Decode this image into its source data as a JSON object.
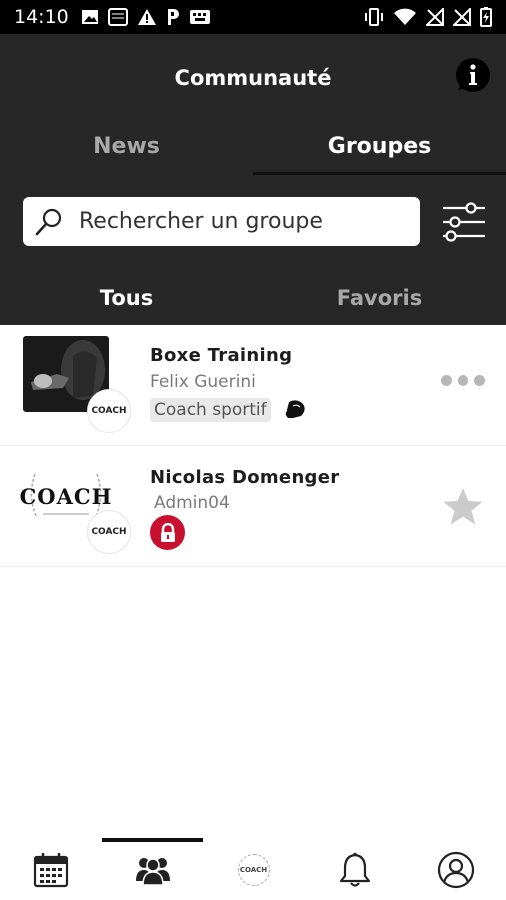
{
  "status_bar": {
    "time": "14:10",
    "left_icons": [
      "image-icon",
      "notes-icon",
      "warning-icon",
      "parking-icon",
      "keyboard-icon"
    ],
    "right_icons": [
      "vibrate-icon",
      "wifi-icon",
      "no-signal-icon",
      "no-signal-icon",
      "battery-charging-icon"
    ]
  },
  "header": {
    "title": "Communauté",
    "info_icon": "info-icon"
  },
  "tabs": {
    "news": "News",
    "groups": "Groupes",
    "active": "groups"
  },
  "search": {
    "placeholder": "Rechercher un groupe",
    "value": ""
  },
  "filter_icon": "sliders-icon",
  "subtabs": {
    "all": "Tous",
    "favorites": "Favoris",
    "active": "all"
  },
  "groups": [
    {
      "name": "Boxe Training",
      "owner": "Felix Guerini",
      "tag": "Coach sportif",
      "tag_icon": "boxing-glove-icon",
      "badge_text": "COACH",
      "action_icon": "more-icon"
    },
    {
      "name": "Nicolas Domenger",
      "owner": "Admin04",
      "logo_text": "COACH",
      "badge_text": "COACH",
      "private_icon": "lock-icon",
      "action_icon": "star-icon"
    }
  ],
  "bottom_nav": {
    "items": [
      {
        "icon": "calendar-icon"
      },
      {
        "icon": "community-icon"
      },
      {
        "icon": "coach-logo-icon",
        "text": "COACH"
      },
      {
        "icon": "bell-icon"
      },
      {
        "icon": "profile-icon"
      }
    ],
    "active_index": 1
  },
  "colors": {
    "header_bg": "#272727",
    "status_bar_bg": "#000000",
    "lock_red": "#c8102e",
    "inactive_tab": "#a8a8a8"
  }
}
